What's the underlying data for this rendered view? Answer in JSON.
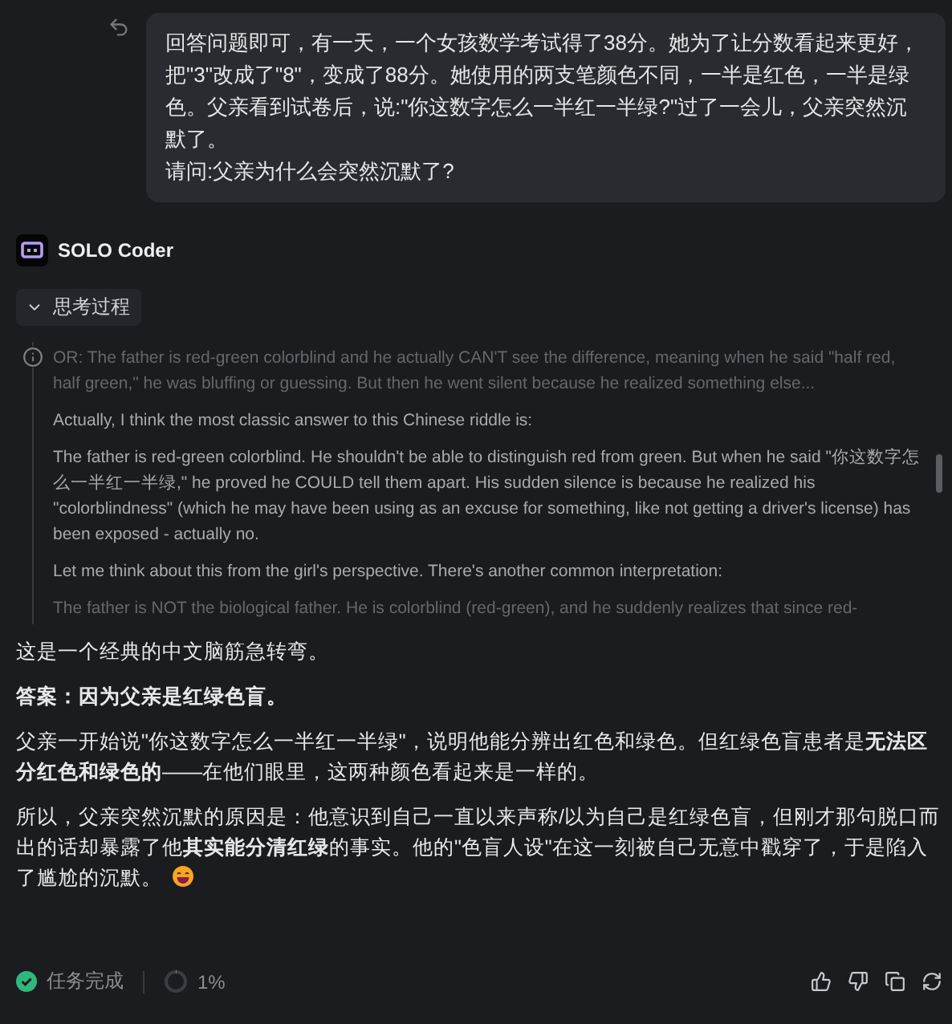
{
  "user_message": {
    "lines": [
      "回答问题即可，有一天，一个女孩数学考试得了38分。她为了让分数看起来更好，把\"3\"改成了\"8\"，变成了88分。她使用的两支笔颜色不同，一半是红色，一半是绿色。父亲看到试卷后，说:\"你这数字怎么一半红一半绿?\"过了一会儿，父亲突然沉默了。",
      "请问:父亲为什么会突然沉默了?"
    ]
  },
  "agent": {
    "name": "SOLO Coder"
  },
  "thinking": {
    "label": "思考过程",
    "expanded": true,
    "paragraphs": [
      {
        "text": "OR: The father is red-green colorblind and he actually CAN'T see the difference, meaning when he said \"half red, half green,\" he was bluffing or guessing. But then he went silent because he realized something else...",
        "faded": true
      },
      {
        "text": "Actually, I think the most classic answer to this Chinese riddle is:",
        "faded": false
      },
      {
        "text": "The father is red-green colorblind. He shouldn't be able to distinguish red from green. But when he said \"你这数字怎么一半红一半绿,\" he proved he COULD tell them apart. His sudden silence is because he realized his \"colorblindness\" (which he may have been using as an excuse for something, like not getting a driver's license) has been exposed - actually no.",
        "faded": false
      },
      {
        "text": "Let me think about this from the girl's perspective. There's another common interpretation:",
        "faded": false
      },
      {
        "text": "The father is NOT the biological father. He is colorblind (red-green), and he suddenly realizes that since red-",
        "faded": true
      }
    ]
  },
  "answer": [
    {
      "text": "这是一个经典的中文脑筋急转弯。",
      "bold": false
    },
    {
      "text": "答案：因为父亲是红绿色盲。",
      "bold": true
    },
    {
      "text": "父亲一开始说\"你这数字怎么一半红一半绿\"，说明他能分辨出红色和绿色。但红绿色盲患者是**无法区分红色和绿色的**——在他们眼里，这两种颜色看起来是一样的。",
      "bold": false
    },
    {
      "text": "所以，父亲突然沉默的原因是：他意识到自己一直以来声称/以为自己是红绿色盲，但刚才那句脱口而出的话却暴露了他**其实能分清红绿**的事实。他的\"色盲人设\"在这一刻被自己无意中戳穿了，于是陷入了尴尬的沉默。",
      "bold": false,
      "emoji": true
    }
  ],
  "footer": {
    "status": "任务完成",
    "progress": {
      "level": 0.01,
      "label": "1%"
    }
  }
}
